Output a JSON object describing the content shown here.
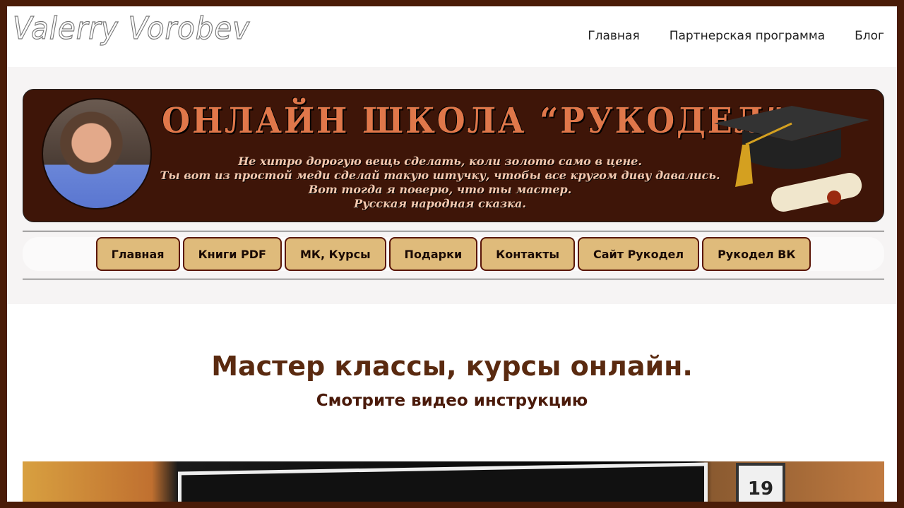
{
  "header": {
    "logo": "Valerry Vorobev",
    "nav": [
      "Главная",
      "Партнерская программа",
      "Блог"
    ]
  },
  "banner": {
    "title": "ОНЛАЙН ШКОЛА “РУКОДЕЛ”",
    "quote": [
      "Не хитро дорогую вещь сделать, коли золото само в цене.",
      "Ты вот из простой меди сделай такую штучку, чтобы все кругом диву давались.",
      "Вот тогда я поверю, что ты мастер.",
      "Русская народная сказка."
    ]
  },
  "menu": [
    "Главная",
    "Книги PDF",
    "МК, Курсы",
    "Подарки",
    "Контакты",
    "Сайт Рукодел",
    "Рукодел ВК"
  ],
  "main": {
    "title": "Мастер классы, курсы онлайн.",
    "subtitle": "Смотрите видео инструкцию",
    "calendar_day": "19"
  }
}
